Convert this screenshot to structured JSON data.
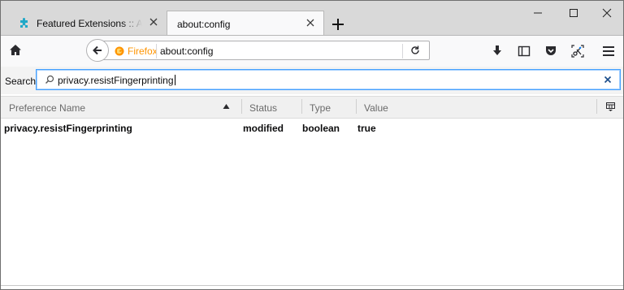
{
  "window": {
    "tabs": [
      {
        "title": "Featured Extensions :: Add-ons for Firefox",
        "active": false
      },
      {
        "title": "about:config",
        "active": true
      }
    ]
  },
  "navbar": {
    "identity_label": "Firefox",
    "url": "about:config"
  },
  "search": {
    "label": "Search:",
    "value": "privacy.resistFingerprinting"
  },
  "table": {
    "columns": [
      "Preference Name",
      "Status",
      "Type",
      "Value"
    ],
    "sort_column": "Preference Name",
    "sort_direction": "ascending",
    "rows": [
      {
        "name": "privacy.resistFingerprinting",
        "status": "modified",
        "type": "boolean",
        "value": "true"
      }
    ]
  },
  "colors": {
    "accent": "#0a84ff",
    "identity": "#ff9400",
    "favicon": "#20a8c8"
  },
  "icons": [
    "puzzle-icon",
    "close-icon",
    "plus-icon",
    "minimize-icon",
    "maximize-icon",
    "home-icon",
    "back-arrow-icon",
    "firefox-icon",
    "reload-icon",
    "download-icon",
    "sidebar-icon",
    "pocket-icon",
    "screenshot-icon",
    "menu-icon",
    "magnifier-icon",
    "clear-icon",
    "sort-arrow-icon",
    "column-picker-icon"
  ]
}
